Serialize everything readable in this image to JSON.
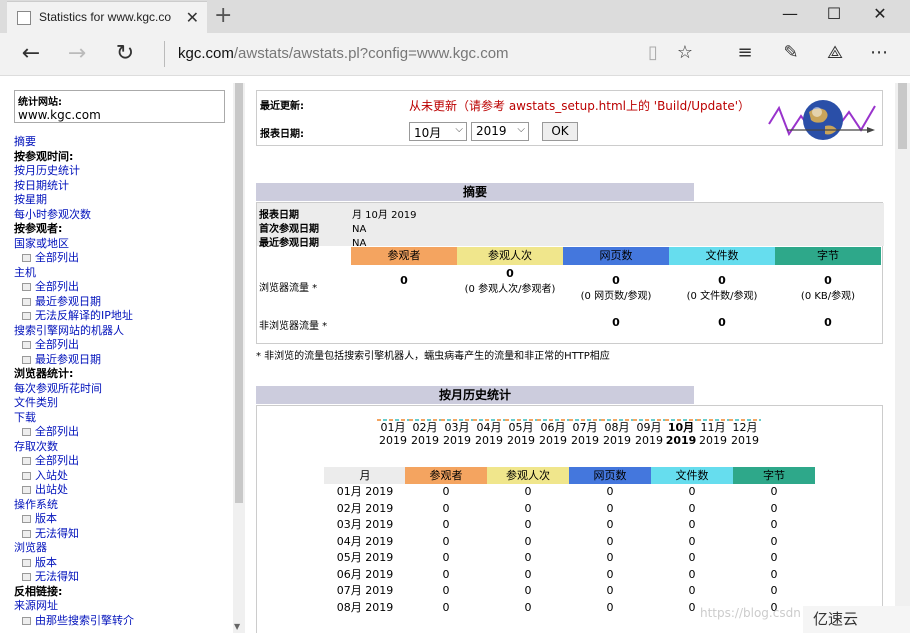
{
  "browser": {
    "tab_title": "Statistics for www.kgc.co",
    "url_host": "kgc.com",
    "url_path": "/awstats/awstats.pl?config=www.kgc.com"
  },
  "sidebar": {
    "site_label": "统计网站:",
    "site_value": "www.kgc.com",
    "items": [
      {
        "type": "link",
        "label": "摘要"
      },
      {
        "type": "head",
        "label": "按参观时间:"
      },
      {
        "type": "link",
        "label": "按月历史统计"
      },
      {
        "type": "link",
        "label": "按日期统计"
      },
      {
        "type": "link",
        "label": "按星期"
      },
      {
        "type": "link",
        "label": "每小时参观次数"
      },
      {
        "type": "head",
        "label": "按参观者:"
      },
      {
        "type": "link",
        "label": "国家或地区"
      },
      {
        "type": "sub",
        "label": "全部列出"
      },
      {
        "type": "link",
        "label": "主机"
      },
      {
        "type": "sub",
        "label": "全部列出"
      },
      {
        "type": "sub",
        "label": "最近参观日期"
      },
      {
        "type": "sub",
        "label": "无法反解译的IP地址"
      },
      {
        "type": "link",
        "label": "搜索引擎网站的机器人"
      },
      {
        "type": "sub",
        "label": "全部列出"
      },
      {
        "type": "sub",
        "label": "最近参观日期"
      },
      {
        "type": "head",
        "label": "浏览器统计:"
      },
      {
        "type": "link",
        "label": "每次参观所花时间"
      },
      {
        "type": "link",
        "label": "文件类别"
      },
      {
        "type": "link",
        "label": "下载"
      },
      {
        "type": "sub",
        "label": "全部列出"
      },
      {
        "type": "link",
        "label": "存取次数"
      },
      {
        "type": "sub",
        "label": "全部列出"
      },
      {
        "type": "sub",
        "label": "入站处"
      },
      {
        "type": "sub",
        "label": "出站处"
      },
      {
        "type": "link",
        "label": "操作系统"
      },
      {
        "type": "sub",
        "label": "版本"
      },
      {
        "type": "sub",
        "label": "无法得知"
      },
      {
        "type": "link",
        "label": "浏览器"
      },
      {
        "type": "sub",
        "label": "版本"
      },
      {
        "type": "sub",
        "label": "无法得知"
      },
      {
        "type": "head",
        "label": "反相链接:"
      },
      {
        "type": "link",
        "label": "来源网址"
      },
      {
        "type": "sub",
        "label": "由那些搜索引擎转介"
      }
    ]
  },
  "top": {
    "last_update_label": "最近更新:",
    "last_update_value": "从未更新（请参考 awstats_setup.html上的 'Build/Update'）",
    "report_date_label": "报表日期:",
    "month_select": "10月",
    "year_select": "2019",
    "ok_label": "OK"
  },
  "summary": {
    "title": "摘要",
    "rows": [
      {
        "k": "报表日期",
        "v": "月 10月 2019"
      },
      {
        "k": "首次参观日期",
        "v": "NA"
      },
      {
        "k": "最近参观日期",
        "v": "NA"
      }
    ],
    "headers": [
      "参观者",
      "参观人次",
      "网页数",
      "文件数",
      "字节"
    ],
    "header_colors": [
      "#f4a460",
      "#f0e68c",
      "#4477dd",
      "#66ddee",
      "#2ea88a"
    ],
    "browser_traffic_label": "浏览器流量 *",
    "browser_traffic": [
      {
        "main": "0",
        "sub": ""
      },
      {
        "main": "0",
        "sub": "(0 参观人次/参观者)"
      },
      {
        "main": "0",
        "sub": "(0 网页数/参观)"
      },
      {
        "main": "0",
        "sub": "(0 文件数/参观)"
      },
      {
        "main": "0",
        "sub": "(0 KB/参观)"
      }
    ],
    "non_browser_label": "非浏览器流量 *",
    "non_browser": [
      "0",
      "0",
      "0"
    ],
    "note": "* 非浏览的流量包括搜索引擎机器人，蠕虫病毒产生的流量和非正常的HTTP相应"
  },
  "monthly": {
    "title": "按月历史统计",
    "months": [
      {
        "m": "01月",
        "y": "2019"
      },
      {
        "m": "02月",
        "y": "2019"
      },
      {
        "m": "03月",
        "y": "2019"
      },
      {
        "m": "04月",
        "y": "2019"
      },
      {
        "m": "05月",
        "y": "2019"
      },
      {
        "m": "06月",
        "y": "2019"
      },
      {
        "m": "07月",
        "y": "2019"
      },
      {
        "m": "08月",
        "y": "2019"
      },
      {
        "m": "09月",
        "y": "2019"
      },
      {
        "m": "10月",
        "y": "2019"
      },
      {
        "m": "11月",
        "y": "2019"
      },
      {
        "m": "12月",
        "y": "2019"
      }
    ],
    "table_headers": [
      "月",
      "参观者",
      "参观人次",
      "网页数",
      "文件数",
      "字节"
    ],
    "rows": [
      {
        "month": "01月 2019",
        "vals": [
          "0",
          "0",
          "0",
          "0",
          "0"
        ]
      },
      {
        "month": "02月 2019",
        "vals": [
          "0",
          "0",
          "0",
          "0",
          "0"
        ]
      },
      {
        "month": "03月 2019",
        "vals": [
          "0",
          "0",
          "0",
          "0",
          "0"
        ]
      },
      {
        "month": "04月 2019",
        "vals": [
          "0",
          "0",
          "0",
          "0",
          "0"
        ]
      },
      {
        "month": "05月 2019",
        "vals": [
          "0",
          "0",
          "0",
          "0",
          "0"
        ]
      },
      {
        "month": "06月 2019",
        "vals": [
          "0",
          "0",
          "0",
          "0",
          "0"
        ]
      },
      {
        "month": "07月 2019",
        "vals": [
          "0",
          "0",
          "0",
          "0",
          "0"
        ]
      },
      {
        "month": "08月 2019",
        "vals": [
          "0",
          "0",
          "0",
          "0",
          "0"
        ]
      }
    ]
  },
  "watermark": "https://blog.csdn",
  "brand": "亿速云"
}
